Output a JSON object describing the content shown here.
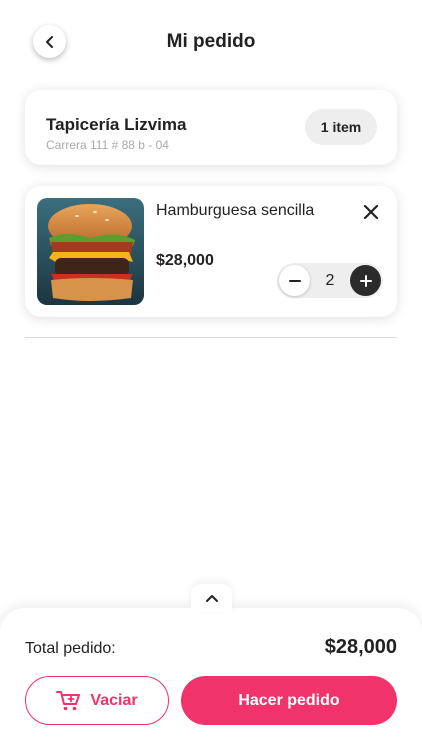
{
  "header": {
    "title": "Mi pedido",
    "back_icon": "chevron-left-icon"
  },
  "store": {
    "name": "Tapicería Lizvima",
    "address": "Carrera 111 # 88 b - 04",
    "items_badge": "1 item"
  },
  "cart": {
    "items": [
      {
        "name": "Hamburguesa sencilla",
        "price": "$28,000",
        "quantity": "2",
        "image": "burger-photo"
      }
    ]
  },
  "footer": {
    "expand_icon": "chevron-up-icon",
    "total_label": "Total pedido:",
    "total_value": "$28,000",
    "empty_label": "Vaciar",
    "empty_icon": "cart-icon",
    "order_label": "Hacer pedido"
  },
  "colors": {
    "accent": "#f0336b",
    "dark": "#2b2b2b",
    "muted": "#aaaaaa",
    "chip": "#eeeeee"
  }
}
